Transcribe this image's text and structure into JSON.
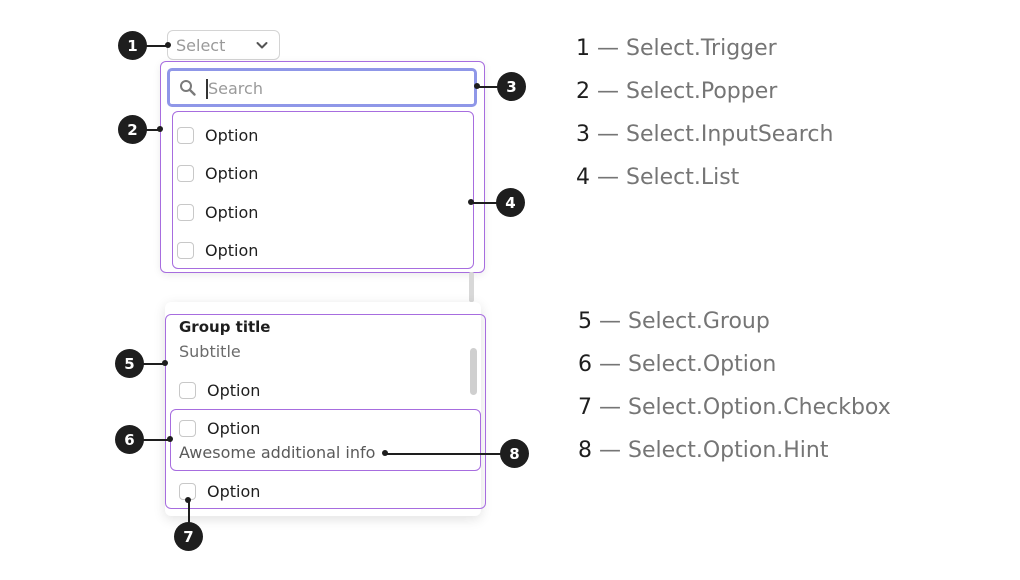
{
  "trigger": {
    "placeholder": "Select"
  },
  "search": {
    "placeholder": "Search"
  },
  "list": {
    "options": [
      "Option",
      "Option",
      "Option",
      "Option"
    ]
  },
  "group": {
    "title": "Group title",
    "subtitle": "Subtitle",
    "options": [
      "Option",
      "Option",
      "Option"
    ],
    "hint": "Awesome additional info"
  },
  "callouts": [
    "1",
    "2",
    "3",
    "4",
    "5",
    "6",
    "7",
    "8"
  ],
  "legend": [
    {
      "num": "1",
      "text": " — Select.Trigger"
    },
    {
      "num": "2",
      "text": " — Select.Popper"
    },
    {
      "num": "3",
      "text": " — Select.InputSearch"
    },
    {
      "num": "4",
      "text": " — Select.List"
    },
    {
      "num": "5",
      "text": " — Select.Group"
    },
    {
      "num": "6",
      "text": " — Select.Option"
    },
    {
      "num": "7",
      "text": " — Select.Option.Checkbox"
    },
    {
      "num": "8",
      "text": " — Select.Option.Hint"
    }
  ],
  "colors": {
    "outline": "#a76ddf",
    "focus": "#8f97e8",
    "badge": "#1e1e1e"
  },
  "icons": [
    "chevron-down-icon",
    "search-icon"
  ]
}
